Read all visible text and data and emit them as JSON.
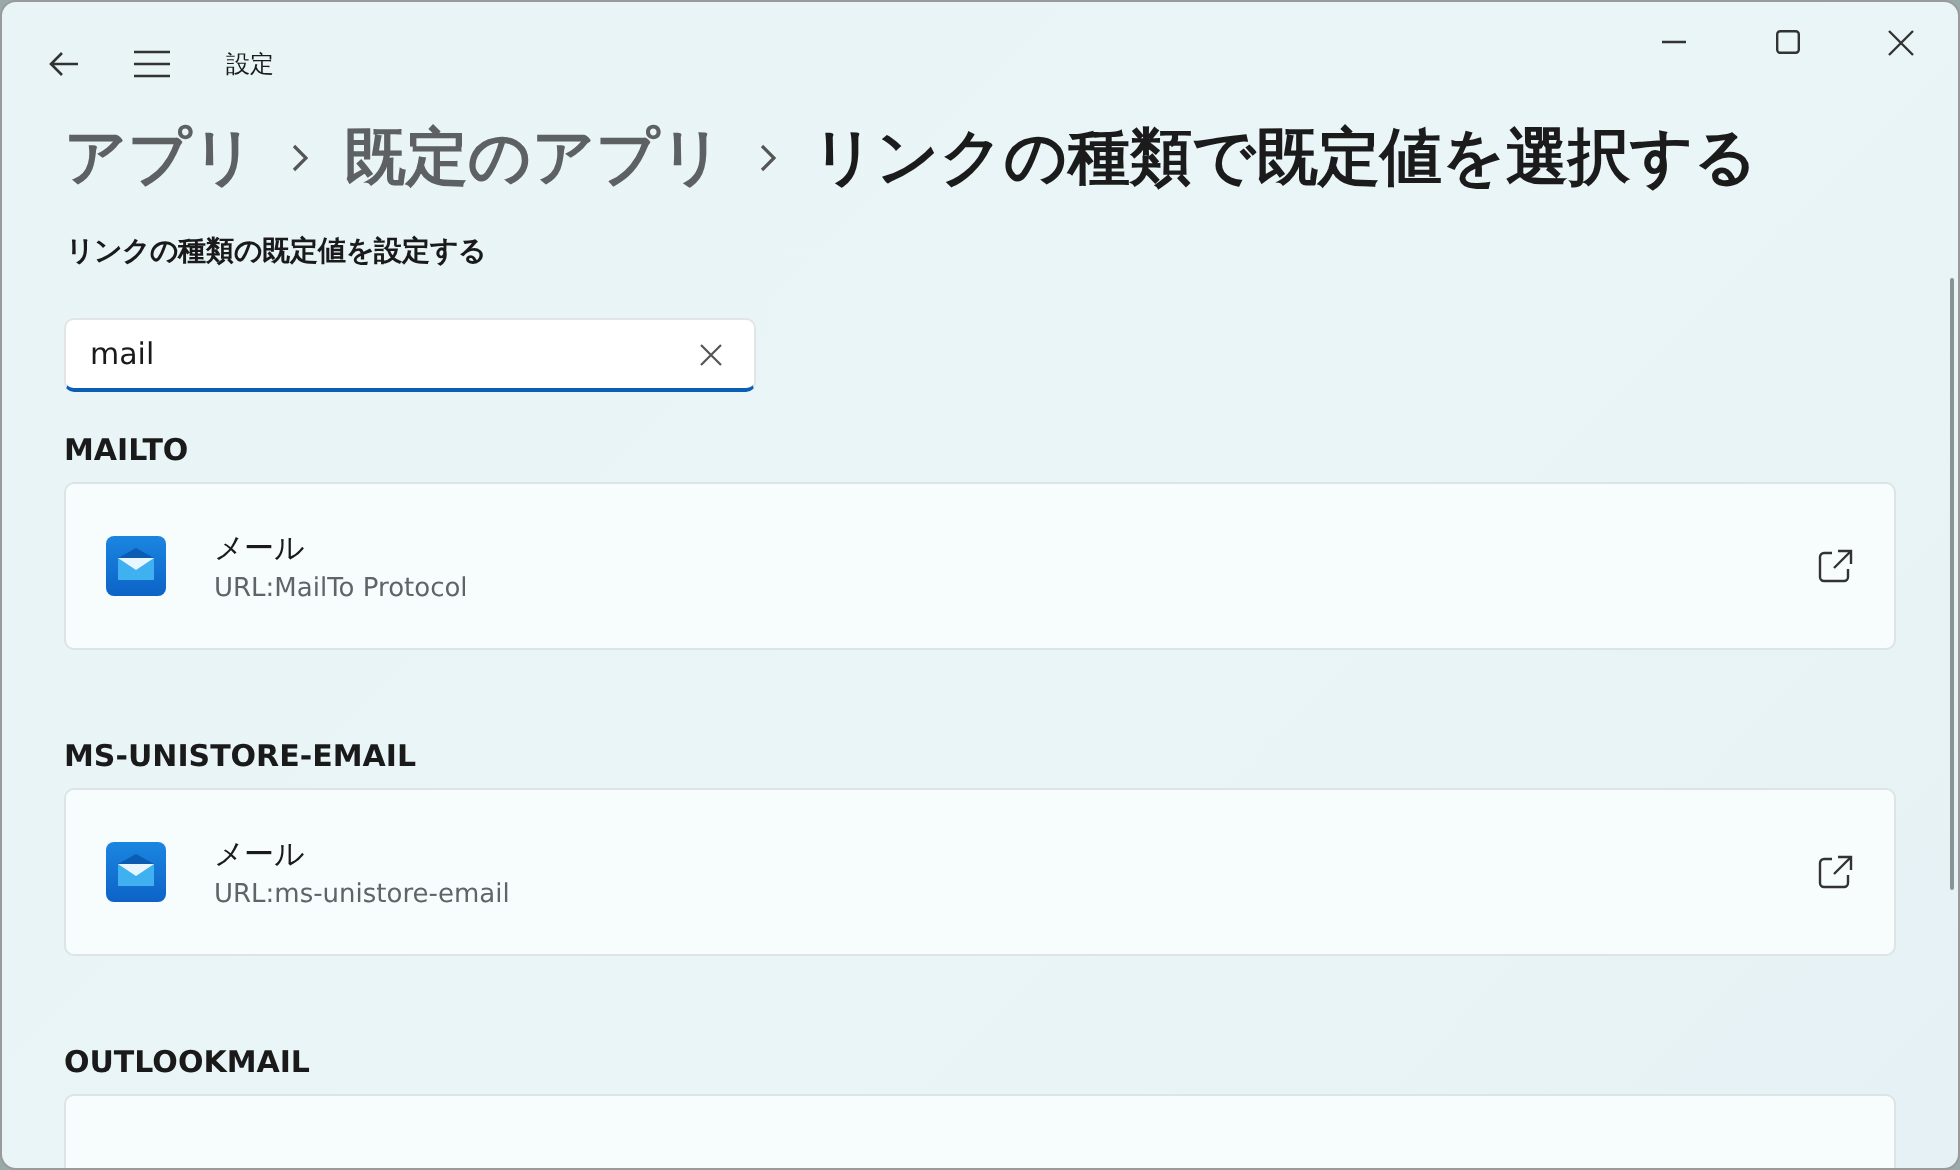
{
  "window": {
    "title": "設定"
  },
  "breadcrumb": [
    {
      "label": "アプリ",
      "current": false
    },
    {
      "label": "既定のアプリ",
      "current": false
    },
    {
      "label": "リンクの種類で既定値を選択する",
      "current": true
    }
  ],
  "subtitle": "リンクの種類の既定値を設定する",
  "search": {
    "value": "mail"
  },
  "sections": [
    {
      "heading": "MAILTO",
      "apps": [
        {
          "name": "メール",
          "description": "URL:MailTo Protocol"
        }
      ]
    },
    {
      "heading": "MS-UNISTORE-EMAIL",
      "apps": [
        {
          "name": "メール",
          "description": "URL:ms-unistore-email"
        }
      ]
    },
    {
      "heading": "OUTLOOKMAIL"
    }
  ]
}
